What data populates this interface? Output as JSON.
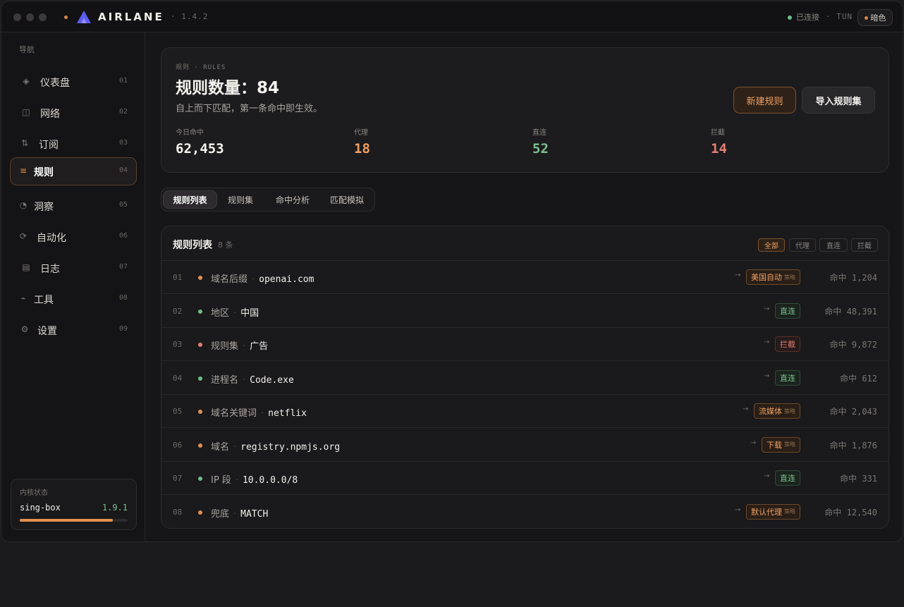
{
  "titlebar": {
    "brand": "AIRLANE",
    "version": "· 1.4.2",
    "connection": "已连接",
    "mode": "· TUN",
    "theme_label": "暗色"
  },
  "sidebar": {
    "title": "导航",
    "items": [
      {
        "icon": "dashboard-icon",
        "glyph": "◈",
        "label": "仪表盘",
        "num": "01"
      },
      {
        "icon": "network-icon",
        "glyph": "◫",
        "label": "网络",
        "num": "02"
      },
      {
        "icon": "subscription-icon",
        "glyph": "⇅",
        "label": "订阅",
        "num": "03"
      },
      {
        "icon": "rules-icon",
        "glyph": "≡",
        "label": "规则",
        "num": "04"
      },
      {
        "icon": "insight-icon",
        "glyph": "◔",
        "label": "洞察",
        "num": "05"
      },
      {
        "icon": "automation-icon",
        "glyph": "⟳",
        "label": "自动化",
        "num": "06"
      },
      {
        "icon": "log-icon",
        "glyph": "▤",
        "label": "日志",
        "num": "07"
      },
      {
        "icon": "tools-icon",
        "glyph": "⌁",
        "label": "工具",
        "num": "08"
      },
      {
        "icon": "settings-icon",
        "glyph": "⚙",
        "label": "设置",
        "num": "09"
      }
    ],
    "active_index": 3,
    "kernel": {
      "title": "内核状态",
      "name": "sing-box",
      "version": "1.9.1",
      "progress": 0.86
    }
  },
  "summary": {
    "crumb": "规则 · RULES",
    "title": "规则数量：84",
    "subtitle": "自上而下匹配，第一条命中即生效。",
    "new_button": "新建规则",
    "import_button": "导入规则集",
    "stats": [
      {
        "label": "今日命中",
        "value": "62,453",
        "color": "#f5f3ef"
      },
      {
        "label": "代理",
        "value": "18",
        "color": "#f0a064"
      },
      {
        "label": "直连",
        "value": "52",
        "color": "#7cc08f"
      },
      {
        "label": "拦截",
        "value": "14",
        "color": "#e57e76"
      }
    ]
  },
  "tabs": [
    "规则列表",
    "规则集",
    "命中分析",
    "匹配模拟"
  ],
  "table": {
    "title": "规则列表",
    "count": "8 条",
    "filters": [
      "全部",
      "代理",
      "直连",
      "拦截"
    ],
    "rows": [
      {
        "num": "01",
        "dot": "#e4904f",
        "type": "域名后缀",
        "value": "openai.com",
        "tag": "美国自动",
        "tag_sub": "策略",
        "tag_kind": "proxy",
        "hits": "命中 1,204"
      },
      {
        "num": "02",
        "dot": "#6fbf86",
        "type": "地区",
        "value": "中国",
        "tag": "直连",
        "tag_sub": "",
        "tag_kind": "direct",
        "hits": "命中 48,391"
      },
      {
        "num": "03",
        "dot": "#e57e76",
        "type": "规则集",
        "value": "广告",
        "tag": "拦截",
        "tag_sub": "",
        "tag_kind": "block",
        "hits": "命中 9,872"
      },
      {
        "num": "04",
        "dot": "#6fbf86",
        "type": "进程名",
        "value": "Code.exe",
        "tag": "直连",
        "tag_sub": "",
        "tag_kind": "direct",
        "hits": "命中 612"
      },
      {
        "num": "05",
        "dot": "#e4904f",
        "type": "域名关键词",
        "value": "netflix",
        "tag": "流媒体",
        "tag_sub": "策略",
        "tag_kind": "proxy",
        "hits": "命中 2,043"
      },
      {
        "num": "06",
        "dot": "#e4904f",
        "type": "域名",
        "value": "registry.npmjs.org",
        "tag": "下载",
        "tag_sub": "策略",
        "tag_kind": "proxy",
        "hits": "命中 1,876"
      },
      {
        "num": "07",
        "dot": "#6fbf86",
        "type": "IP 段",
        "value": "10.0.0.0/8",
        "tag": "直连",
        "tag_sub": "",
        "tag_kind": "direct",
        "hits": "命中 331"
      },
      {
        "num": "08",
        "dot": "#e4904f",
        "type": "兜底",
        "value": "MATCH",
        "tag": "默认代理",
        "tag_sub": "策略",
        "tag_kind": "proxy",
        "hits": "命中 12,540"
      }
    ]
  }
}
